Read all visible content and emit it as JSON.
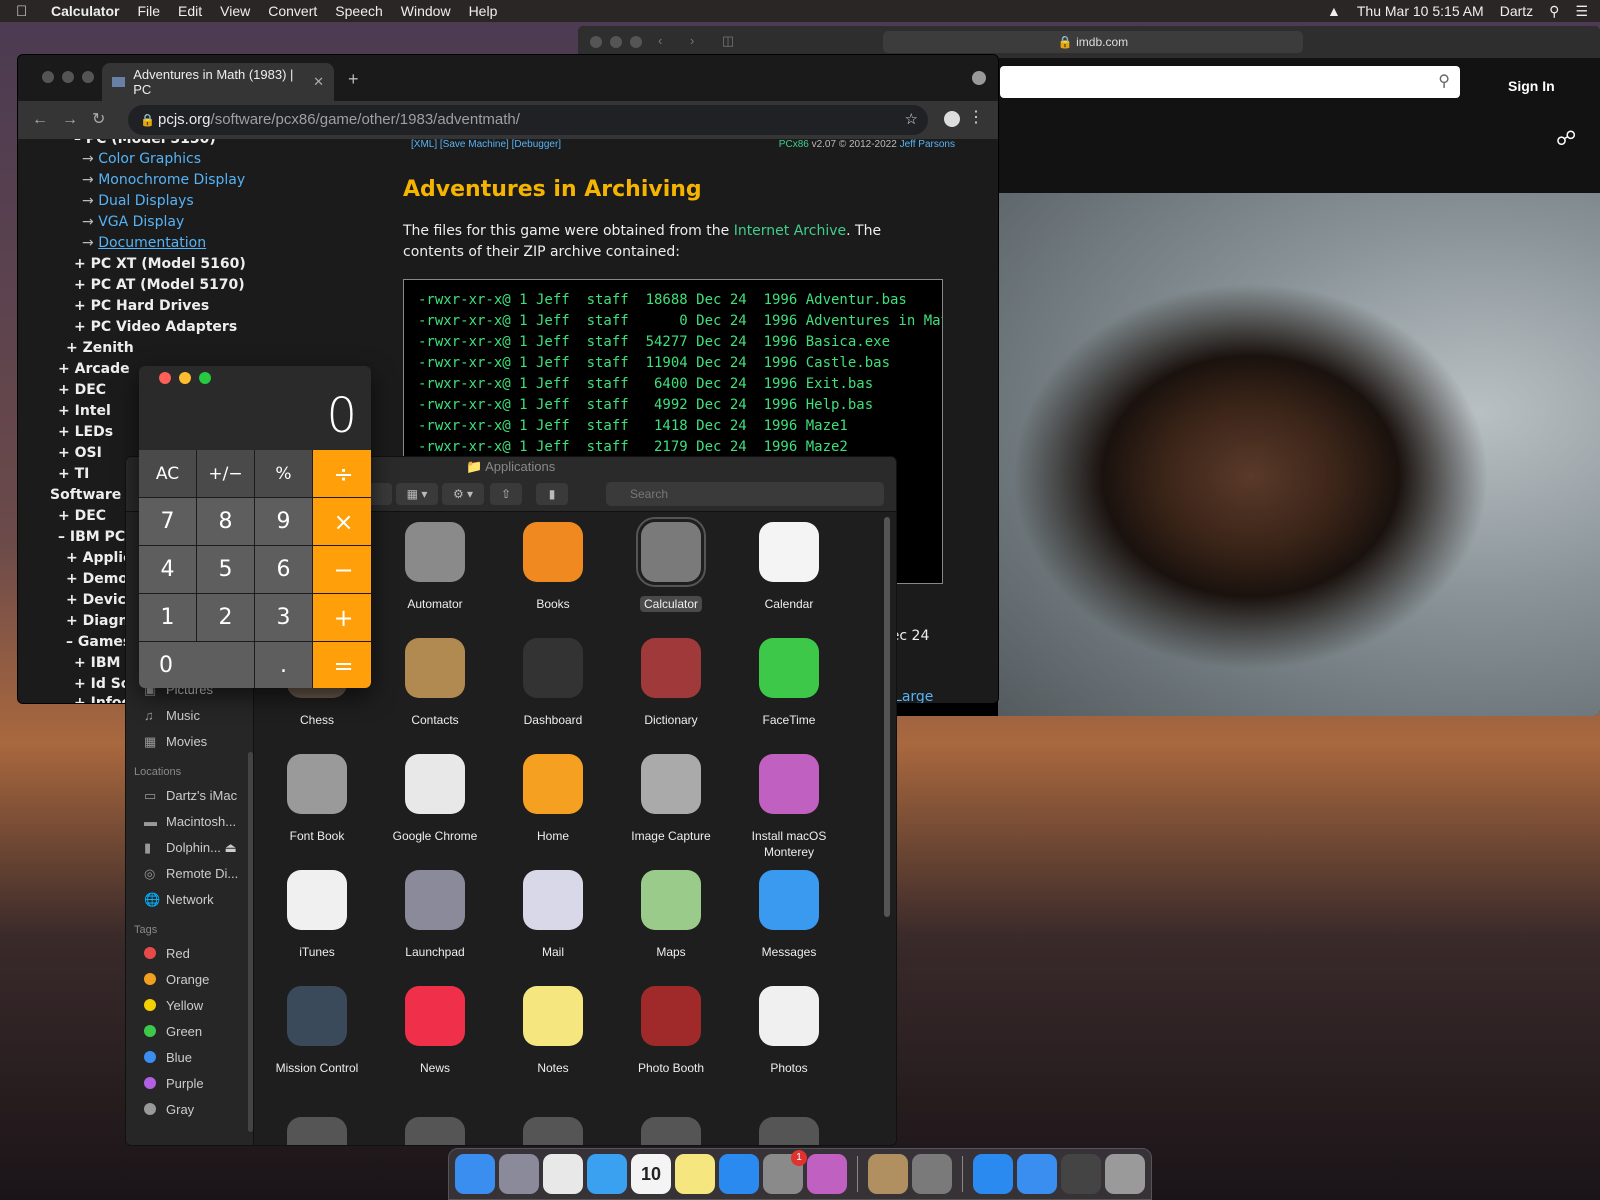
{
  "menubar": {
    "app": "Calculator",
    "items": [
      "File",
      "Edit",
      "View",
      "Convert",
      "Speech",
      "Window",
      "Help"
    ],
    "clock": "Thu Mar 10  5:15 AM",
    "user": "Dartz"
  },
  "safari": {
    "url": "imdb.com",
    "sign_in": "Sign In"
  },
  "chrome": {
    "tab_title": "Adventures in Math (1983) | PC",
    "url_host": "pcjs.org",
    "url_path": "/software/pcx86/game/other/1983/adventmath/",
    "tree": [
      "– PC (Model 5150)",
      "Color Graphics",
      "Monochrome Display",
      "Dual Displays",
      "VGA Display",
      "Documentation",
      "+ PC XT (Model 5160)",
      "+ PC AT (Model 5170)",
      "+ PC Hard Drives",
      "+ PC Video Adapters",
      "+ Zenith",
      "+ Arcade",
      "+ DEC",
      "+ Intel",
      "+ LEDs",
      "+ OSI",
      "+ TI",
      "Software",
      "+ DEC",
      "– IBM PC",
      "+ Applica",
      "+ Demos",
      "+ Device",
      "+ Diagno",
      "– Games",
      "+ IBM",
      "+ Id Sof",
      "+ Infoc"
    ],
    "meta_links": "[XML]  [Save Machine]  [Debugger]",
    "meta_pcx86": "PCx86",
    "meta_version": " v2.07 © 2012-2022 ",
    "meta_author": "Jeff Parsons",
    "heading": "Adventures in Archiving",
    "para_before": "The files for this game were obtained from the ",
    "para_link": "Internet Archive",
    "para_after": ". The contents of their ZIP archive contained:",
    "listing": [
      "-rwxr-xr-x@ 1 Jeff  staff  18688 Dec 24  1996 Adventur.bas",
      "-rwxr-xr-x@ 1 Jeff  staff      0 Dec 24  1996 Adventures in Mat",
      "-rwxr-xr-x@ 1 Jeff  staff  54277 Dec 24  1996 Basica.exe",
      "-rwxr-xr-x@ 1 Jeff  staff  11904 Dec 24  1996 Castle.bas",
      "-rwxr-xr-x@ 1 Jeff  staff   6400 Dec 24  1996 Exit.bas",
      "-rwxr-xr-x@ 1 Jeff  staff   4992 Dec 24  1996 Help.bas",
      "-rwxr-xr-x@ 1 Jeff  staff   1418 Dec 24  1996 Maze1",
      "-rwxr-xr-x@ 1 Jeff  staff   2179 Dec 24  1996 Maze2"
    ],
    "partial_00": "00",
    "partial_al": "al",
    "partial_dec24": "Dec 24",
    "partial_alarge": "A Large"
  },
  "finder": {
    "title": "Applications",
    "search_placeholder": "Search",
    "sidebar_top": [
      "Pictures",
      "Music",
      "Movies"
    ],
    "locations_head": "Locations",
    "locations": [
      "Dartz's iMac",
      "Macintosh...",
      "Dolphin...",
      "Remote Di...",
      "Network"
    ],
    "tags_head": "Tags",
    "tags": [
      {
        "name": "Red",
        "color": "#e84a4a"
      },
      {
        "name": "Orange",
        "color": "#f0a020"
      },
      {
        "name": "Yellow",
        "color": "#f5d000"
      },
      {
        "name": "Green",
        "color": "#3ec84a"
      },
      {
        "name": "Blue",
        "color": "#3a8ef0"
      },
      {
        "name": "Purple",
        "color": "#b060e0"
      },
      {
        "name": "Gray",
        "color": "#999999"
      }
    ],
    "apps": [
      {
        "name": "Automator",
        "color": "#8a8a8a",
        "icon": "automator-icon"
      },
      {
        "name": "Books",
        "color": "#f08a20",
        "icon": "books-icon"
      },
      {
        "name": "Calculator",
        "color": "#7a7a7a",
        "icon": "calculator-icon"
      },
      {
        "name": "Calendar",
        "color": "#f4f4f4",
        "icon": "calendar-icon"
      },
      {
        "name": "Chess",
        "color": "#6a5a4a",
        "icon": "chess-icon"
      },
      {
        "name": "Contacts",
        "color": "#b08a50",
        "icon": "contacts-icon"
      },
      {
        "name": "Dashboard",
        "color": "#333333",
        "icon": "dashboard-icon"
      },
      {
        "name": "Dictionary",
        "color": "#a03a3a",
        "icon": "dictionary-icon"
      },
      {
        "name": "FaceTime",
        "color": "#3ec84a",
        "icon": "facetime-icon"
      },
      {
        "name": "Font Book",
        "color": "#9a9a9a",
        "icon": "font-book-icon"
      },
      {
        "name": "Google Chrome",
        "color": "#e8e8e8",
        "icon": "chrome-icon"
      },
      {
        "name": "Home",
        "color": "#f5a020",
        "icon": "home-icon"
      },
      {
        "name": "Image Capture",
        "color": "#aaaaaa",
        "icon": "image-capture-icon"
      },
      {
        "name": "Install macOS Monterey",
        "color": "#c060c0",
        "icon": "install-macos-icon"
      },
      {
        "name": "iTunes",
        "color": "#f0f0f0",
        "icon": "itunes-icon"
      },
      {
        "name": "Launchpad",
        "color": "#8a8a9a",
        "icon": "launchpad-icon"
      },
      {
        "name": "Mail",
        "color": "#d8d8e8",
        "icon": "mail-icon"
      },
      {
        "name": "Maps",
        "color": "#9acb8a",
        "icon": "maps-icon"
      },
      {
        "name": "Messages",
        "color": "#3a9af0",
        "icon": "messages-icon"
      },
      {
        "name": "Mission Control",
        "color": "#3a4a5a",
        "icon": "mission-control-icon"
      },
      {
        "name": "News",
        "color": "#f0304a",
        "icon": "news-icon"
      },
      {
        "name": "Notes",
        "color": "#f5e680",
        "icon": "notes-icon"
      },
      {
        "name": "Photo Booth",
        "color": "#a02a2a",
        "icon": "photo-booth-icon"
      },
      {
        "name": "Photos",
        "color": "#f0f0f0",
        "icon": "photos-icon"
      }
    ]
  },
  "calculator": {
    "display": "0",
    "keys": [
      {
        "label": "AC",
        "kind": "fn",
        "name": "clear-button"
      },
      {
        "label": "+∕−",
        "kind": "fn",
        "name": "sign-button"
      },
      {
        "label": "%",
        "kind": "fn",
        "name": "percent-button"
      },
      {
        "label": "÷",
        "kind": "op",
        "name": "divide-button"
      },
      {
        "label": "7",
        "kind": "num",
        "name": "digit-7-button"
      },
      {
        "label": "8",
        "kind": "num",
        "name": "digit-8-button"
      },
      {
        "label": "9",
        "kind": "num",
        "name": "digit-9-button"
      },
      {
        "label": "×",
        "kind": "op",
        "name": "multiply-button"
      },
      {
        "label": "4",
        "kind": "num",
        "name": "digit-4-button"
      },
      {
        "label": "5",
        "kind": "num",
        "name": "digit-5-button"
      },
      {
        "label": "6",
        "kind": "num",
        "name": "digit-6-button"
      },
      {
        "label": "−",
        "kind": "op",
        "name": "subtract-button"
      },
      {
        "label": "1",
        "kind": "num",
        "name": "digit-1-button"
      },
      {
        "label": "2",
        "kind": "num",
        "name": "digit-2-button"
      },
      {
        "label": "3",
        "kind": "num",
        "name": "digit-3-button"
      },
      {
        "label": "+",
        "kind": "op",
        "name": "add-button"
      },
      {
        "label": "0",
        "kind": "num zero",
        "name": "digit-0-button"
      },
      {
        "label": ".",
        "kind": "num",
        "name": "decimal-button"
      },
      {
        "label": "=",
        "kind": "op",
        "name": "equals-button"
      }
    ]
  },
  "dock": {
    "items": [
      {
        "name": "finder-icon",
        "color": "#3a8ef0"
      },
      {
        "name": "launchpad-icon",
        "color": "#8a8a9a"
      },
      {
        "name": "chrome-icon",
        "color": "#e8e8e8"
      },
      {
        "name": "safari-icon",
        "color": "#3aa0f0"
      },
      {
        "name": "calendar-icon",
        "color": "#f4f4f4"
      },
      {
        "name": "notes-icon",
        "color": "#f5e680"
      },
      {
        "name": "app-store-icon",
        "color": "#2a8af0"
      },
      {
        "name": "system-preferences-icon",
        "color": "#8a8a8a"
      },
      {
        "name": "install-macos-icon",
        "color": "#c060c0"
      },
      {
        "name": "chess-icon",
        "color": "#b09060"
      },
      {
        "name": "calculator-icon",
        "color": "#7a7a7a"
      },
      {
        "name": "app-store-folder-icon",
        "color": "#2a8af0"
      },
      {
        "name": "downloads-icon",
        "color": "#3a8ef0"
      },
      {
        "name": "screenshot-icon",
        "color": "#444444"
      },
      {
        "name": "trash-icon",
        "color": "#9a9a9a"
      }
    ],
    "calendar_month": "MAR",
    "calendar_day": "10",
    "badge": "1"
  }
}
